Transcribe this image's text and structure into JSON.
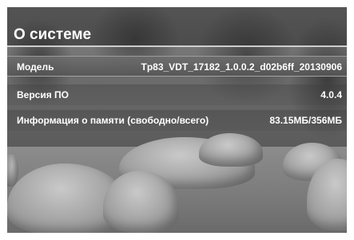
{
  "screen": {
    "title": "О системе"
  },
  "info_rows": [
    {
      "label": "Модель",
      "value": "Tp83_VDT_17182_1.0.0.2_d02b6ff_20130906"
    },
    {
      "label": "Версия ПО",
      "value": "4.0.4"
    },
    {
      "label": "Информация о памяти (свободно/всего)",
      "value": "83.15МБ/356МБ"
    }
  ],
  "selected_row": "Модель",
  "colors": {
    "text": "#ffffff",
    "separator": "#e6e6e6",
    "selection": "#6e6e6e"
  }
}
